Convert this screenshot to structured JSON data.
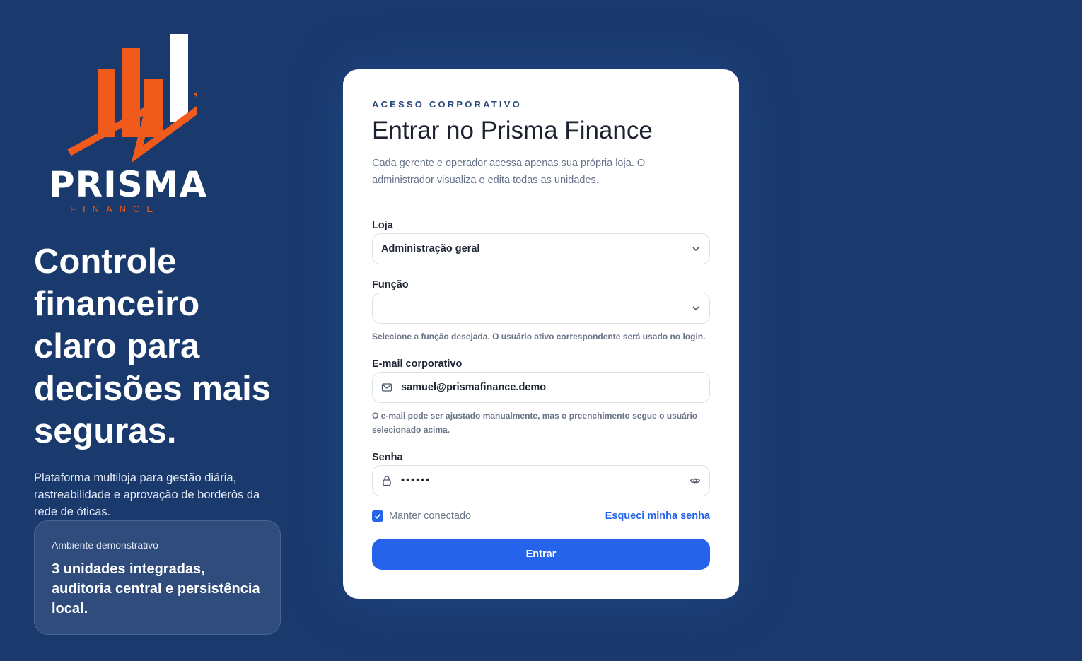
{
  "brand": {
    "name": "PRISMA",
    "subtitle": "FINANCE",
    "logo_colors": {
      "orange": "#f05a1a",
      "white": "#ffffff"
    }
  },
  "hero": {
    "headline": "Controle financeiro claro para decisões mais seguras.",
    "lead": "Plataforma multiloja para gestão diária, rastreabilidade e aprovação de borderôs da rede de óticas.",
    "demo_label": "Ambiente demonstrativo",
    "demo_text": "3 unidades integradas, auditoria central e persistência local."
  },
  "login": {
    "eyebrow": "ACESSO CORPORATIVO",
    "title": "Entrar no Prisma Finance",
    "description": "Cada gerente e operador acessa apenas sua própria loja. O administrador visualiza e edita todas as unidades.",
    "store": {
      "label": "Loja",
      "value": "Administração geral",
      "icon": "chevron-down-icon"
    },
    "role": {
      "label": "Função",
      "value": "",
      "hint": "Selecione a função desejada. O usuário ativo correspondente será usado no login.",
      "icon": "chevron-down-icon"
    },
    "email": {
      "label": "E-mail corporativo",
      "value": "samuel@prismafinance.demo",
      "hint": "O e-mail pode ser ajustado manualmente, mas o preenchimento segue o usuário selecionado acima.",
      "icon": "mail-icon"
    },
    "password": {
      "label": "Senha",
      "value": "••••••",
      "icon": "lock-icon",
      "toggle_icon": "eye-icon"
    },
    "remember": {
      "label": "Manter conectado",
      "checked": true
    },
    "forgot_label": "Esqueci minha senha",
    "submit_label": "Entrar"
  },
  "colors": {
    "background": "#1a3a6e",
    "accent": "#2563eb",
    "brand_orange": "#f05a1a"
  }
}
